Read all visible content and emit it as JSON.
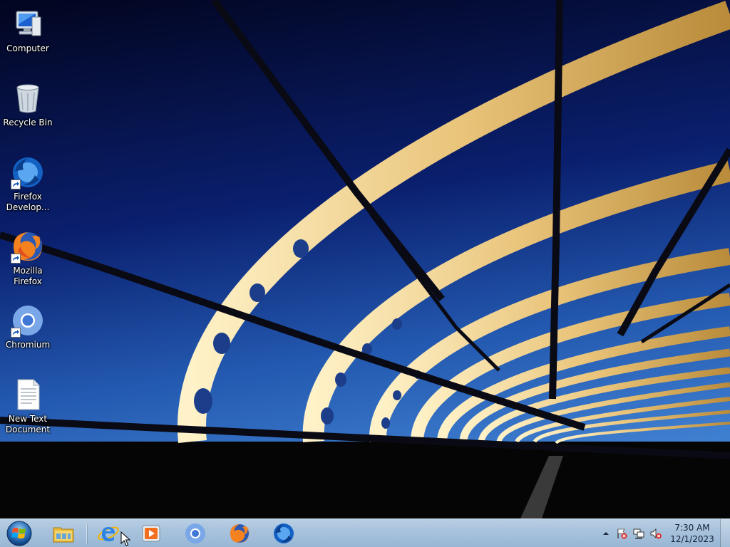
{
  "desktop": {
    "icons": [
      {
        "label": "Computer",
        "icon": "computer-icon"
      },
      {
        "label": "Recycle Bin",
        "icon": "recycle-bin-icon"
      },
      {
        "label": "Firefox\nDevelop...",
        "icon": "firefox-developer-icon",
        "shortcut": true
      },
      {
        "label": "Mozilla\nFirefox",
        "icon": "firefox-icon",
        "shortcut": true
      },
      {
        "label": "Chromium",
        "icon": "chromium-icon",
        "shortcut": true
      },
      {
        "label": "New Text\nDocument",
        "icon": "text-document-icon"
      }
    ]
  },
  "taskbar": {
    "pinned": [
      {
        "icon": "file-explorer-icon"
      },
      {
        "icon": "internet-explorer-icon"
      },
      {
        "icon": "media-player-icon"
      },
      {
        "icon": "chromium-icon"
      },
      {
        "icon": "firefox-icon"
      },
      {
        "icon": "firefox-developer-icon"
      }
    ],
    "tray": {
      "icons": [
        "show-hidden-icons-chevron",
        "action-center-flag-icon",
        "network-icon",
        "volume-muted-icon"
      ],
      "time": "7:30 AM",
      "date": "12/1/2023"
    }
  },
  "colors": {
    "sky_top": "#03082e",
    "sky_bottom": "#2a63b8",
    "truss_gold": "#e8c57a",
    "taskbar": "#a9c3dd"
  }
}
